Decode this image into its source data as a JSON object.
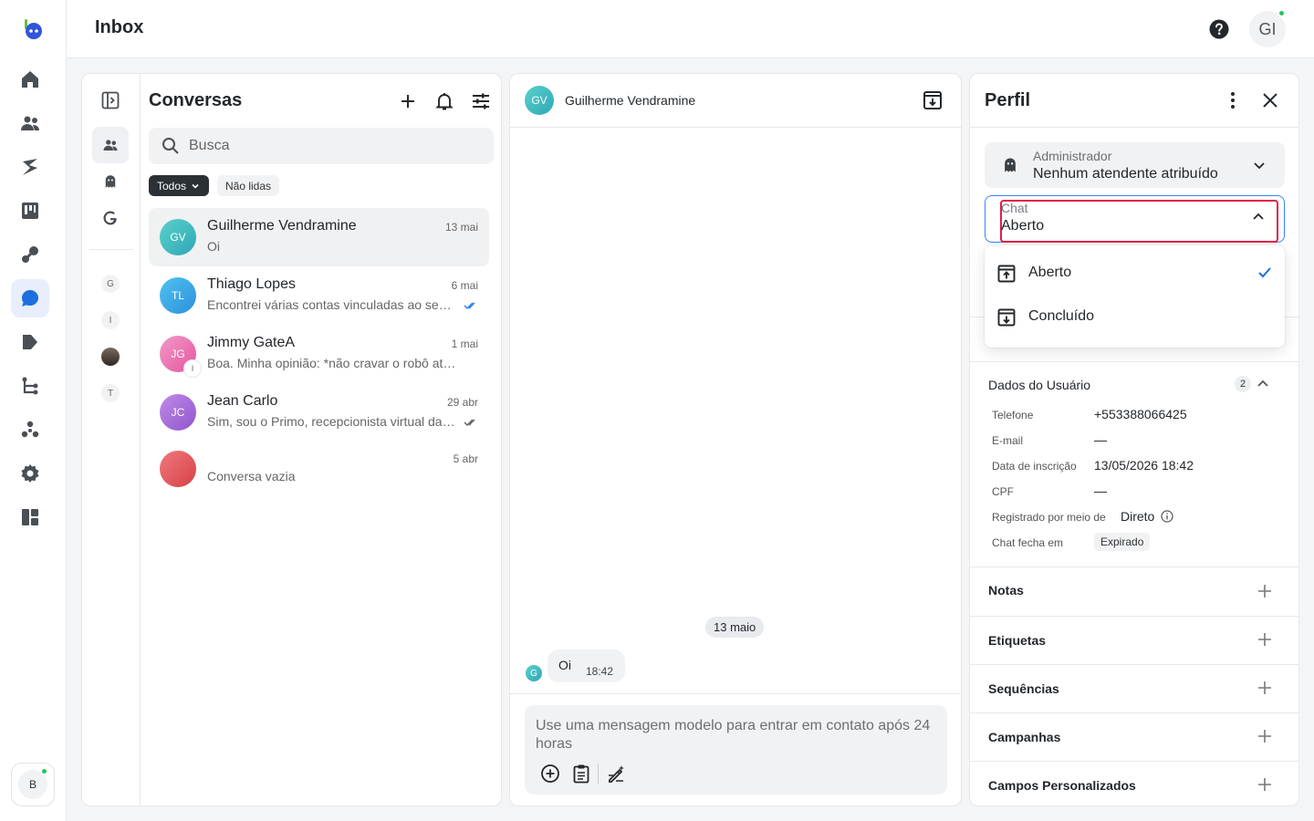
{
  "header": {
    "title": "Inbox",
    "user_initials": "GI"
  },
  "rail": {
    "bottom_initial": "B"
  },
  "inbox": {
    "title": "Conversas",
    "search_placeholder": "Busca",
    "filter_all": "Todos",
    "filter_unread": "Não lidas",
    "subrail_letters": [
      "G",
      "I",
      "T"
    ],
    "conversations": [
      {
        "initials": "GV",
        "name": "Guilherme Vendramine",
        "date": "13 mai",
        "preview": "Oi",
        "color": "#3fc4c0"
      },
      {
        "initials": "TL",
        "name": "Thiago Lopes",
        "date": "6 mai",
        "preview": "Encontrei várias contas vinculadas ao seu número e não consegui identificar",
        "color": "#3aa9e8"
      },
      {
        "initials": "JG",
        "name": "Jimmy GateA",
        "date": "1 mai",
        "preview": "Boa. Minha opinião: *não cravar o robô atual como está, mas também não",
        "color": "#ec6aa8",
        "badge": "I"
      },
      {
        "initials": "JC",
        "name": "Jean Carlo",
        "date": "29 abr",
        "preview": "Sim, sou o Primo, recepcionista virtual da empresa. Como posso ajudar?",
        "color": "#a26ad6"
      },
      {
        "initials": "",
        "name": "",
        "date": "5 abr",
        "preview": "Conversa vazia",
        "color": "#e05a5f"
      }
    ]
  },
  "chat": {
    "contact_initials": "GV",
    "contact_name": "Guilherme Vendramine",
    "date_divider": "13 maio",
    "message_avatar": "G",
    "message_text": "Oi",
    "message_time": "18:42",
    "composer_placeholder": "Use uma mensagem modelo para entrar em contato após 24 horas"
  },
  "profile": {
    "title": "Perfil",
    "agent_label": "Administrador",
    "agent_value": "Nenhum atendente atribuído",
    "chat_label": "Chat",
    "chat_value": "Aberto",
    "menu_options": [
      "Aberto",
      "Concluído"
    ],
    "user_section": {
      "title": "Dados do Usuário",
      "count": "2",
      "rows": [
        {
          "key": "Telefone",
          "value": "+553388066425"
        },
        {
          "key": "E-mail",
          "value": "—"
        },
        {
          "key": "Data de inscrição",
          "value": "13/05/2026 18:42"
        },
        {
          "key": "CPF",
          "value": "—"
        },
        {
          "key": "Registrado por meio de",
          "value": "Direto"
        },
        {
          "key": "Chat fecha em",
          "value": "Expirado"
        }
      ]
    },
    "sections": [
      "Notas",
      "Etiquetas",
      "Sequências",
      "Campanhas",
      "Campos Personalizados"
    ]
  },
  "colors": {
    "accent": "#1d6fe0",
    "highlight": "#e11d48",
    "online": "#22c55e"
  }
}
